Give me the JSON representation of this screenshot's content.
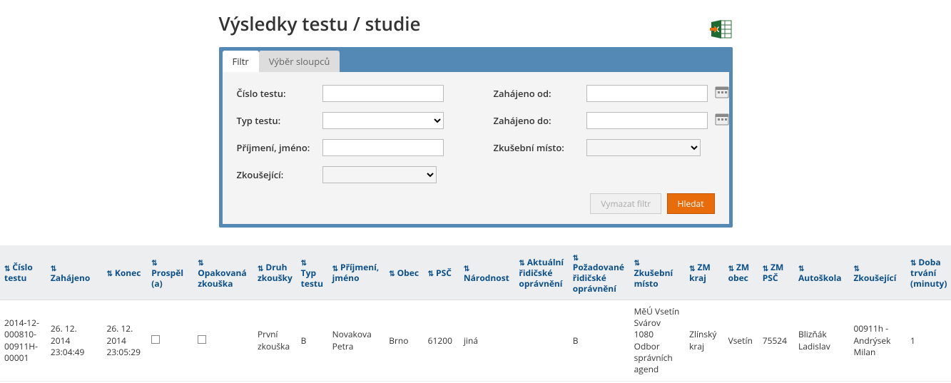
{
  "title": "Výsledky testu / studie",
  "tabs": {
    "filter": "Filtr",
    "columns": "Výběr sloupců"
  },
  "form": {
    "labels": {
      "test_number": "Číslo testu:",
      "test_type": "Typ testu:",
      "name": "Příjmení, jméno:",
      "examiner": "Zkoušející:",
      "started_from": "Zahájeno od:",
      "started_to": "Zahájeno do:",
      "exam_place": "Zkušební místo:"
    },
    "values": {
      "test_number": "",
      "test_type": "",
      "name": "",
      "examiner": "",
      "started_from": "",
      "started_to": "",
      "exam_place": ""
    },
    "buttons": {
      "clear": "Vymazat filtr",
      "search": "Hledat"
    }
  },
  "columns": {
    "c0": "Číslo testu",
    "c1": "Zahájeno",
    "c2": "Konec",
    "c3": "Prospěl (a)",
    "c4": "Opakovaná zkouška",
    "c5": "Druh zkoušky",
    "c6": "Typ testu",
    "c7": "Příjmení, jméno",
    "c8": "Obec",
    "c9": "PSČ",
    "c10": "Národnost",
    "c11": "Aktuální řidičské oprávnění",
    "c12": "Požadované řidičské oprávnění",
    "c13": "Zkušební místo",
    "c14": "ZM kraj",
    "c15": "ZM obec",
    "c16": "ZM PSČ",
    "c17": "Autoškola",
    "c18": "Zkoušející",
    "c19": "Doba trvání (minuty)"
  },
  "row": {
    "c0": "2014-12-000810-00911H-00001",
    "c1": "26. 12. 2014 23:04:49",
    "c2": "26. 12. 2014 23:05:29",
    "c5": "První zkouška",
    "c6": "B",
    "c7": "Novakova Petra",
    "c8": "Brno",
    "c9": "61200",
    "c10": "jiná",
    "c11": "",
    "c12": "B",
    "c13": "MěÚ Vsetín Svárov 1080 Odbor správních agend",
    "c14": "Zlínský kraj",
    "c15": "Vsetín",
    "c16": "75524",
    "c17": "Blizňák Ladislav",
    "c18": "00911h - Andrýsek Milan",
    "c19": "1"
  }
}
